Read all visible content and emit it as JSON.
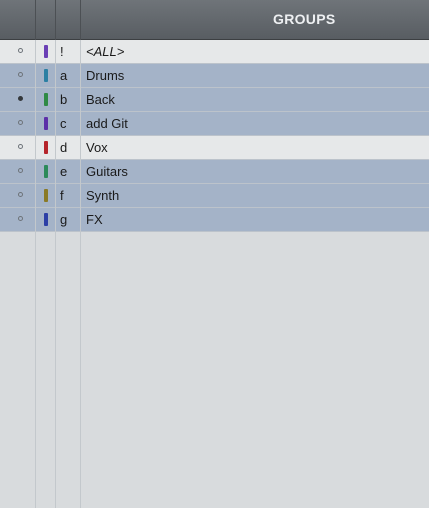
{
  "header": {
    "title": "GROUPS"
  },
  "groups": [
    {
      "letter": "!",
      "name": "<ALL>",
      "color": "#6a3fb5",
      "active": false,
      "dot": "hollow",
      "italic": true
    },
    {
      "letter": "a",
      "name": "Drums",
      "color": "#2b7fa3",
      "active": true,
      "dot": "hollow",
      "italic": false
    },
    {
      "letter": "b",
      "name": "Back",
      "color": "#2f8a45",
      "active": true,
      "dot": "filled",
      "italic": false
    },
    {
      "letter": "c",
      "name": "add Git",
      "color": "#5c2fa8",
      "active": true,
      "dot": "hollow",
      "italic": false
    },
    {
      "letter": "d",
      "name": "Vox",
      "color": "#b5242b",
      "active": false,
      "dot": "hollow",
      "italic": false
    },
    {
      "letter": "e",
      "name": "Guitars",
      "color": "#2c8a5a",
      "active": true,
      "dot": "hollow",
      "italic": false
    },
    {
      "letter": "f",
      "name": "Synth",
      "color": "#8a7a26",
      "active": true,
      "dot": "hollow",
      "italic": false
    },
    {
      "letter": "g",
      "name": "FX",
      "color": "#2c3fa6",
      "active": true,
      "dot": "hollow",
      "italic": false
    }
  ]
}
